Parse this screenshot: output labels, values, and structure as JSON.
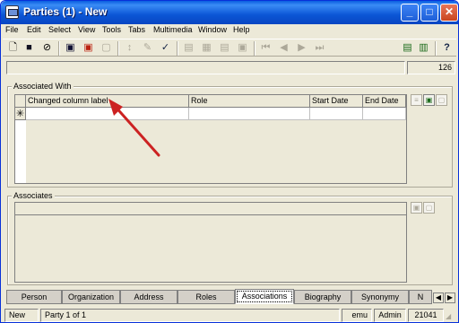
{
  "window": {
    "title": "Parties (1) - New",
    "minimize": "_",
    "maximize": "□",
    "close": "✕"
  },
  "menu": [
    "File",
    "Edit",
    "Select",
    "View",
    "Tools",
    "Tabs",
    "Multimedia",
    "Window",
    "Help"
  ],
  "toolbar": {
    "icons": [
      "new-doc-icon",
      "save-icon",
      "cancel-icon",
      "new-record-icon",
      "delete-record-icon",
      "copy-record-icon",
      "sort-icon",
      "edit-icon",
      "spellcheck-icon",
      "layout1-icon",
      "layout2-icon",
      "layout3-icon",
      "layout4-icon",
      "first-icon",
      "prev-icon",
      "next-icon",
      "last-icon",
      "report-icon",
      "export-icon",
      "help-icon"
    ]
  },
  "record_count": "126",
  "associated_with": {
    "label": "Associated With",
    "columns": [
      "Changed column label",
      "Role",
      "Start Date",
      "End Date"
    ],
    "new_row_marker": "✳"
  },
  "associates": {
    "label": "Associates"
  },
  "annotation": {
    "color": "#cc2222"
  },
  "tabs": [
    "Person",
    "Organization",
    "Address",
    "Roles",
    "Associations",
    "Biography",
    "Synonymy",
    "N"
  ],
  "active_tab": "Associations",
  "status": {
    "mode": "New",
    "position": "Party 1 of 1",
    "module": "emu",
    "user": "Admin",
    "irn": "21041"
  }
}
